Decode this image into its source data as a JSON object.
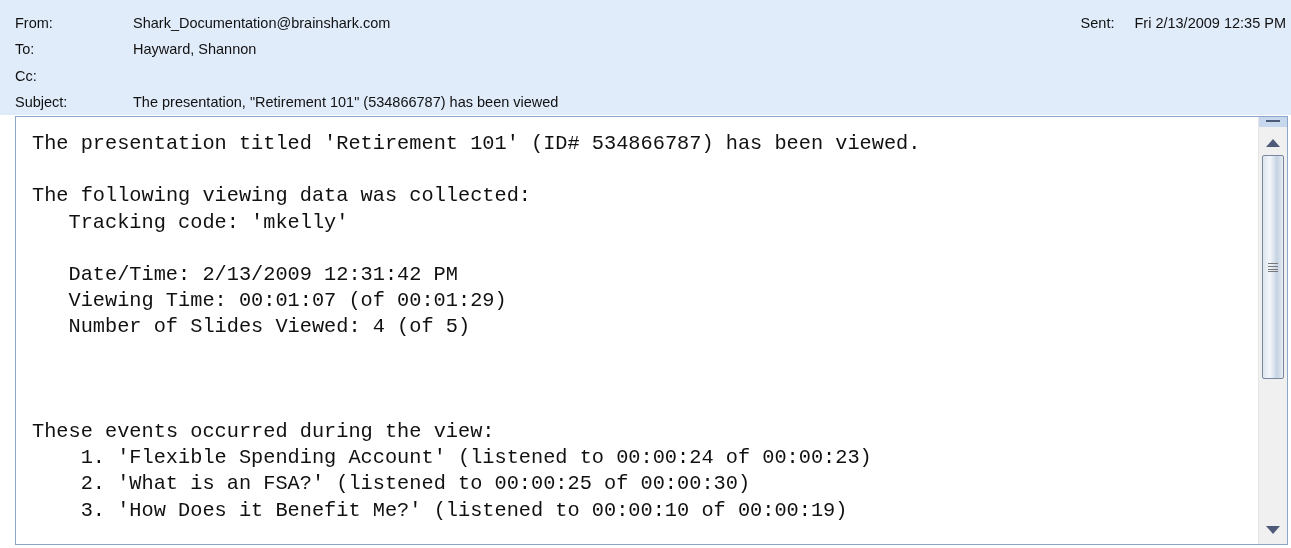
{
  "header": {
    "fields": [
      {
        "label": "From:",
        "value": "Shark_Documentation@brainshark.com"
      },
      {
        "label": "To:",
        "value": "Hayward, Shannon"
      },
      {
        "label": "Cc:"
      },
      {
        "label": "Subject:",
        "value": "The presentation, \"Retirement 101\" (534866787) has been viewed"
      }
    ],
    "sent": {
      "label": "Sent:",
      "value": "Fri 2/13/2009 12:35 PM"
    }
  },
  "body": {
    "intro": "The presentation titled 'Retirement 101' (ID# 534866787) has been viewed.",
    "collected": {
      "heading": "The following viewing data was collected:",
      "tracking": "Tracking code: 'mkelly'",
      "details": [
        "Date/Time: 2/13/2009 12:31:42 PM",
        "Viewing Time: 00:01:07 (of 00:01:29)",
        "Number of Slides Viewed: 4 (of 5)"
      ]
    },
    "events": {
      "heading": "These events occurred during the view:",
      "items": [
        {
          "number": "1.",
          "text": "'Flexible Spending Account' (listened to 00:00:24 of 00:00:23)"
        },
        {
          "number": "2.",
          "text": "'What is an FSA?' (listened to 00:00:25 of 00:00:30)"
        },
        {
          "number": "3.",
          "text": "'How Does it Benefit Me?' (listened to 00:00:10 of 00:00:19)"
        }
      ]
    }
  }
}
